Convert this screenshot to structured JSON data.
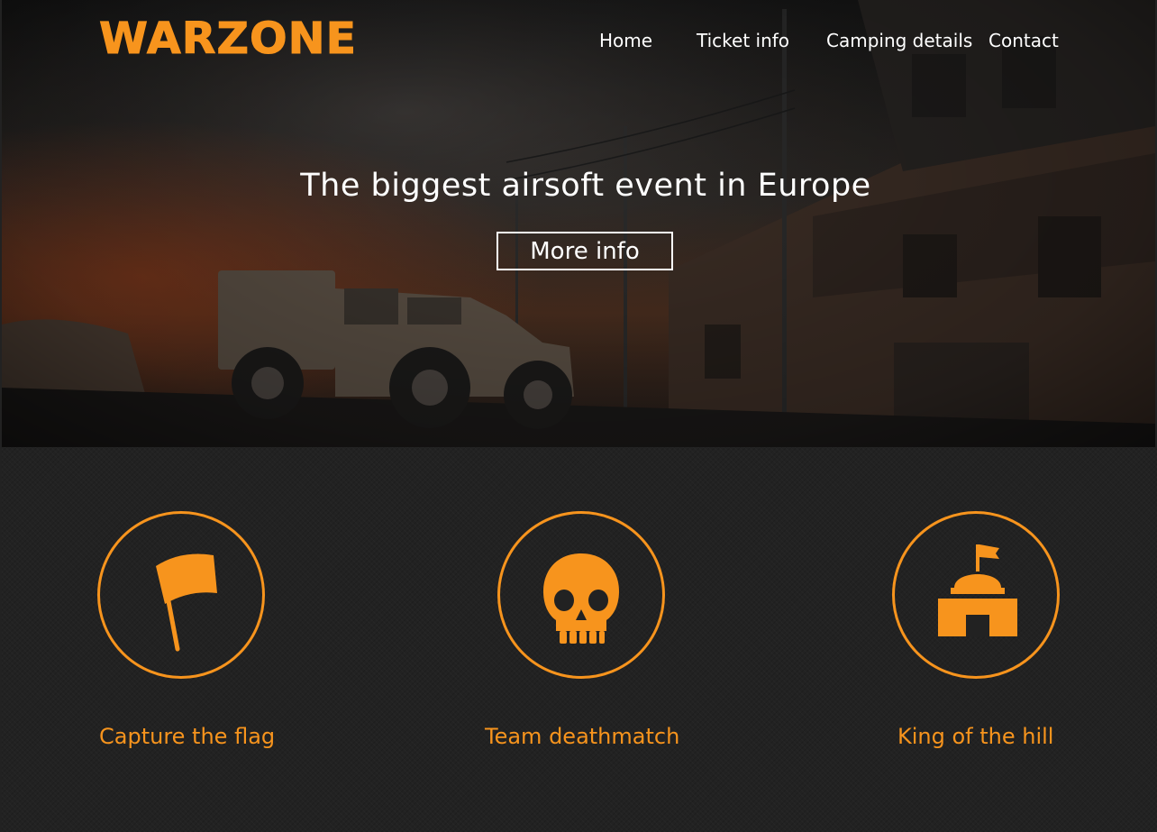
{
  "brand": {
    "logo_text": "WARZONE",
    "accent_color": "#f7941d"
  },
  "nav": {
    "items": [
      {
        "label": "Home"
      },
      {
        "label": "Ticket info"
      },
      {
        "label": "Camping details"
      },
      {
        "label": "Contact"
      }
    ]
  },
  "hero": {
    "headline": "The biggest airsoft event in Europe",
    "cta_label": "More info"
  },
  "features": [
    {
      "label": "Capture the flag",
      "icon": "flag-icon"
    },
    {
      "label": "Team deathmatch",
      "icon": "skull-icon"
    },
    {
      "label": "King of the hill",
      "icon": "fort-with-flag-icon"
    }
  ]
}
